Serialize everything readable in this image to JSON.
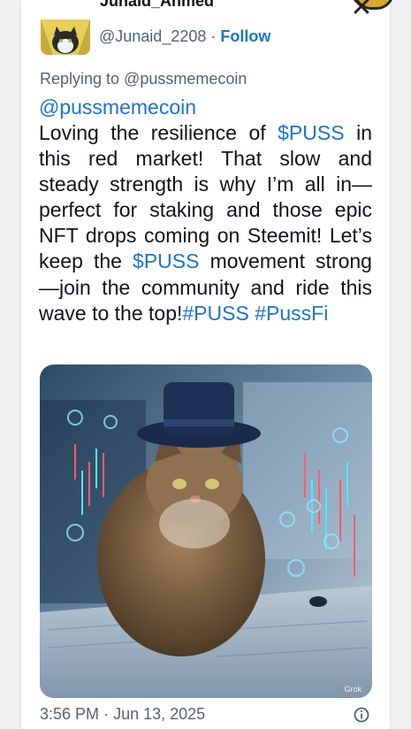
{
  "author": {
    "display_name": "Junaid_Ahmed",
    "handle": "@Junaid_2208",
    "separator": "·",
    "follow_label": "Follow"
  },
  "reply": {
    "label": "Replying to @pussmemecoin",
    "mention": "@pussmemecoin"
  },
  "tweet": {
    "segments": [
      {
        "text": " Loving the resilience of ",
        "link": false
      },
      {
        "text": "$PUSS",
        "link": true
      },
      {
        "text": " in this red market! That slow and steady strength is why I’m all in—perfect for staking and those epic NFT drops coming on Steemit! Let’s keep the ",
        "link": false
      },
      {
        "text": "$PUSS",
        "link": true
      },
      {
        "text": " movement strong—join the community and ride this wave to the top!",
        "link": false
      },
      {
        "text": "#PUSS",
        "link": true
      },
      {
        "text": " ",
        "link": false
      },
      {
        "text": "#PussFi",
        "link": true
      }
    ]
  },
  "media": {
    "alt": "Cat wearing a top hat in front of trading charts",
    "watermark": "Grok"
  },
  "meta": {
    "time": "3:56 PM",
    "separator": "·",
    "date": "Jun 13, 2025"
  },
  "icons": {
    "close": "close-icon",
    "info": "info-icon"
  },
  "colors": {
    "link": "#1d73c9",
    "secondary_text": "#536471",
    "primary_text": "#0f1419"
  }
}
